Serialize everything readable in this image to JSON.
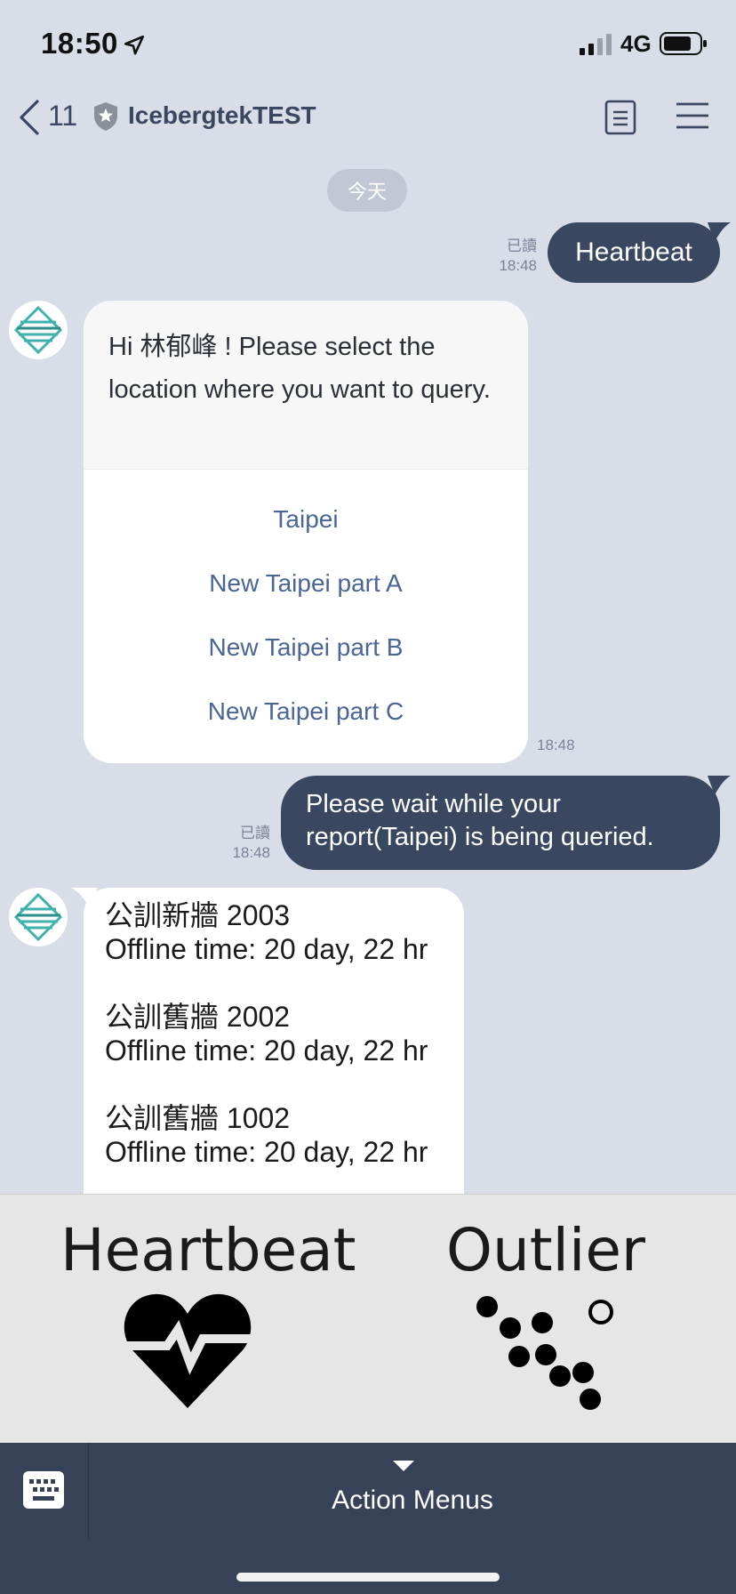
{
  "status_bar": {
    "time": "18:50",
    "network": "4G"
  },
  "nav": {
    "back_count": "11",
    "title": "IcebergtekTEST"
  },
  "chat": {
    "date_divider": "今天",
    "msg1": {
      "text": "Heartbeat",
      "read": "已讀",
      "time": "18:48"
    },
    "card": {
      "prompt": "Hi 林郁峰 ! Please select the location where you want to query.",
      "actions": [
        "Taipei",
        "New Taipei part A",
        "New Taipei part B",
        "New Taipei part C"
      ],
      "time": "18:48"
    },
    "msg2": {
      "text": "Please wait while your report(Taipei) is being queried.",
      "read": "已讀",
      "time": "18:48"
    },
    "status_report": [
      {
        "name": "公訓新牆 2003",
        "detail": "Offline time: 20 day, 22 hr"
      },
      {
        "name": "公訓舊牆 2002",
        "detail": "Offline time: 20 day, 22 hr"
      },
      {
        "name": "公訓舊牆 1002",
        "detail": "Offline time: 20 day, 22 hr"
      }
    ]
  },
  "rich_menu": {
    "left_label": "Heartbeat",
    "right_label": "Outlier"
  },
  "action_bar": {
    "label": "Action Menus"
  },
  "colors": {
    "background": "#d8dde8",
    "outgoing_bubble": "#3a4760",
    "link": "#4a6596",
    "action_bar": "#374258"
  },
  "icons": [
    "location-arrow-icon",
    "signal-icon",
    "battery-icon",
    "back-chevron-icon",
    "shield-star-icon",
    "notes-icon",
    "hamburger-menu-icon",
    "bot-avatar-icon",
    "heartbeat-icon",
    "outlier-dots-icon",
    "keyboard-icon",
    "caret-down-icon"
  ]
}
